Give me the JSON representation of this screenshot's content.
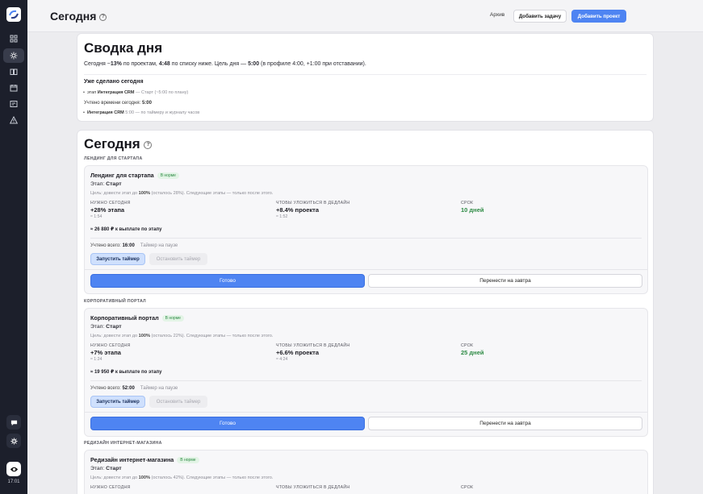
{
  "sidebar": {
    "clock": "17:01",
    "items": [
      "dashboard-icon",
      "today-icon",
      "book-icon",
      "calendar-icon",
      "report-icon",
      "warning-icon"
    ]
  },
  "header": {
    "title": "Сегодня",
    "help": "?",
    "archive": "Архив",
    "add_task": "Добавить задачу",
    "add_project": "Добавить проект"
  },
  "summary": {
    "title": "Сводка дня",
    "line_p1": "Сегодня ~",
    "line_pct": "13%",
    "line_p2": " по проектам, ",
    "line_time": "4:48",
    "line_p3": " по списку ниже. Цель дня — ",
    "line_goal": "5:00",
    "line_p4": " (в профиле 4:00, +1:00 при отставании).",
    "done_title": "Уже сделано сегодня",
    "done_item_prefix": "этап ",
    "done_item_name": "Интеграция CRM",
    "done_item_rest": " — Старт (~5:00 по плану)",
    "accounted_label": "Учтено времени сегодня: ",
    "accounted_value": "5:00",
    "acc_item_name": "Интеграция CRM",
    "acc_item_rest": " 5:00 — по таймеру и журналу часов"
  },
  "today": {
    "title": "Сегодня",
    "help": "?",
    "labels": {
      "stage": "Этап: ",
      "need_today": "НУЖНО СЕГОДНЯ",
      "deadline": "ЧТОБЫ УЛОЖИТЬСЯ В ДЕДЛАЙН",
      "due": "СРОК",
      "accounted": "Учтено всего: ",
      "start_timer": "Запустить таймер",
      "stop_timer": "Остановить таймер",
      "done": "Готово",
      "move": "Перенести на завтра",
      "goal_p1": "Цель: довести этап до ",
      "goal_p2": "100%",
      "goal_p3": " (осталось ",
      "goal_p4": "). Следующие этапы — только после этого."
    },
    "projects": [
      {
        "group": "ЛЕНДИНГ ДЛЯ СТАРТАПА",
        "name": "Лендинг для стартапа",
        "status": "В норме",
        "stage": "Старт",
        "remaining": "28%",
        "need_value": "+28% этапа",
        "need_sub": "≈ 1:54",
        "deadline_value": "+8.4% проекта",
        "deadline_sub": "≈ 1:52",
        "due_value": "10 дней",
        "payout": "≈ 26 880 ₽ к выплате по этапу",
        "accounted": "16:00",
        "timer_status": "Таймер на паузе"
      },
      {
        "group": "КОРПОРАТИВНЫЙ ПОРТАЛ",
        "name": "Корпоративный портал",
        "status": "В норме",
        "stage": "Старт",
        "remaining": "22%",
        "need_value": "+7% этапа",
        "need_sub": "≈ 1:24",
        "deadline_value": "+6.6% проекта",
        "deadline_sub": "≈ 4:24",
        "due_value": "25 дней",
        "payout": "≈ 19 950 ₽ к выплате по этапу",
        "accounted": "52:00",
        "timer_status": "Таймер на паузе"
      },
      {
        "group": "РЕДИЗАЙН ИНТЕРНЕТ-МАГАЗИНА",
        "name": "Редизайн интернет-магазина",
        "status": "В норме",
        "stage": "Старт",
        "remaining": "42%"
      }
    ]
  },
  "colors": {
    "accent": "#4e84f2",
    "sidebar": "#1c1f2b",
    "ok_green": "#2d8a44"
  }
}
